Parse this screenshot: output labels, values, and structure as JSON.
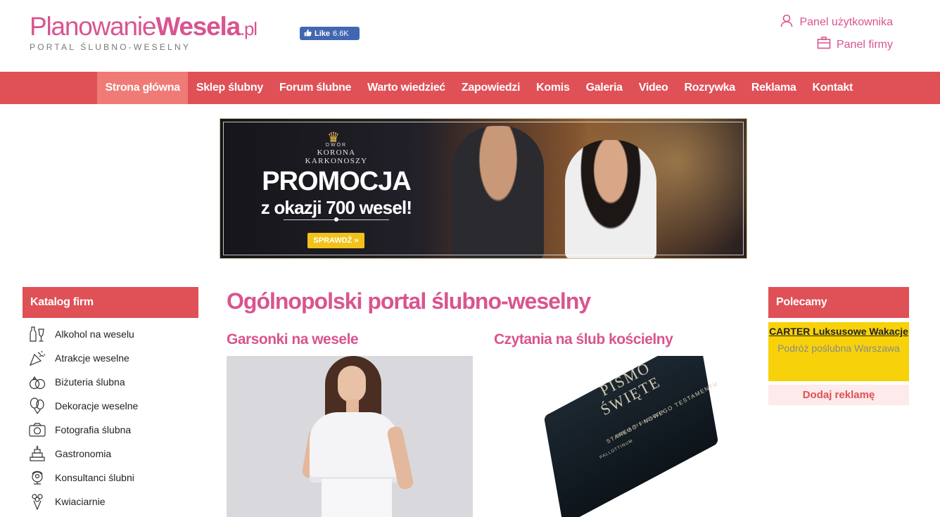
{
  "header": {
    "logo": {
      "part1": "Planowanie",
      "part2": "Wesela",
      "part3": ".pl",
      "tagline": "PORTAL ŚLUBNO-WESELNY"
    },
    "facebook": {
      "label": "Like",
      "count": "6.6K"
    },
    "user_panel": "Panel użytkownika",
    "company_panel": "Panel firmy"
  },
  "nav": {
    "items": [
      "Strona główna",
      "Sklep ślubny",
      "Forum ślubne",
      "Warto wiedzieć",
      "Zapowiedzi",
      "Komis",
      "Galeria",
      "Video",
      "Rozrywka",
      "Reklama",
      "Kontakt"
    ],
    "active_index": 0
  },
  "banner": {
    "brand_small": "DWÓR",
    "brand": "KORONA KARKONOSZY",
    "headline": "PROMOCJA",
    "subheadline": "z okazji 700 wesel!",
    "cta": "SPRAWDŹ »"
  },
  "catalog": {
    "title": "Katalog firm",
    "items": [
      {
        "label": "Alkohol na weselu",
        "icon": "bottle-glass-icon"
      },
      {
        "label": "Atrakcje weselne",
        "icon": "party-popper-icon"
      },
      {
        "label": "Biżuteria ślubna",
        "icon": "rings-icon"
      },
      {
        "label": "Dekoracje weselne",
        "icon": "balloons-icon"
      },
      {
        "label": "Fotografia ślubna",
        "icon": "camera-icon"
      },
      {
        "label": "Gastronomia",
        "icon": "cake-icon"
      },
      {
        "label": "Konsultanci ślubni",
        "icon": "consultant-icon"
      },
      {
        "label": "Kwiaciarnie",
        "icon": "bouquet-icon"
      }
    ]
  },
  "main": {
    "title": "Ogólnopolski portal ślubno-weselny",
    "articles": [
      {
        "title": "Garsonki na wesele"
      },
      {
        "title": "Czytania na ślub kościelny",
        "image_text": {
          "line1": "PISMO",
          "line2": "ŚWIĘTE",
          "line3": "STAREGO I NOWEGO TESTAMENTU",
          "line4": "BIBLIA TYSIĄCLECIA",
          "line5": "PALLOTTINUM"
        }
      }
    ]
  },
  "recommended": {
    "title": "Polecamy",
    "ad_title": "CARTER Luksusowe Wakacje",
    "ad_subtitle": "Podróż poślubna Warszawa",
    "add_ad_label": "Dodaj reklamę"
  },
  "colors": {
    "brand_pink": "#d9548f",
    "nav_red": "#e05057",
    "nav_active": "#f07a75",
    "ad_yellow": "#f7d20a"
  }
}
